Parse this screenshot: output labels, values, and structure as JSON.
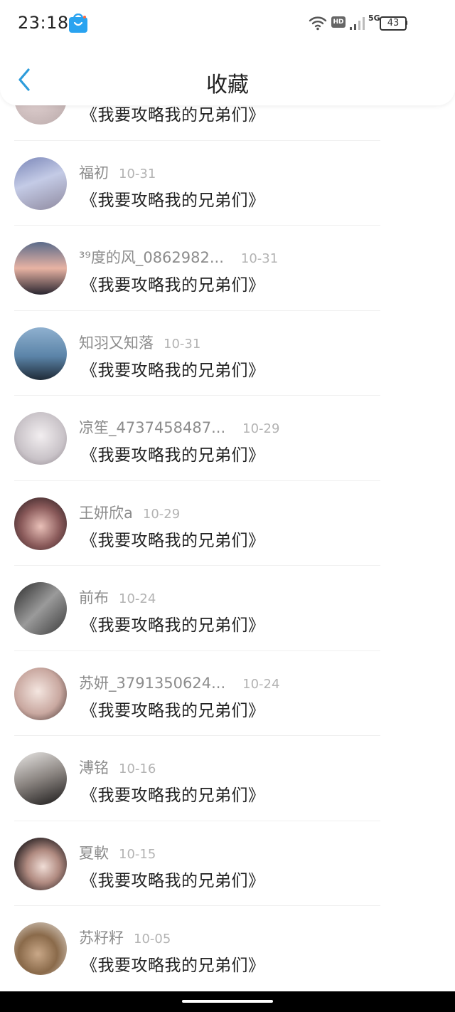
{
  "status_bar": {
    "time": "23:18",
    "network": "5G",
    "hd": "HD",
    "battery": "43"
  },
  "nav": {
    "title": "收藏",
    "back_icon": "chevron-left-icon",
    "accent_color": "#2d9cdb"
  },
  "list": {
    "items": [
      {
        "username": "",
        "date": "",
        "title": "《我要攻略我的兄弟们》"
      },
      {
        "username": "福初",
        "date": "10-31",
        "title": "《我要攻略我的兄弟们》"
      },
      {
        "username": "³⁹度的风_0862982...",
        "date": "10-31",
        "title": "《我要攻略我的兄弟们》"
      },
      {
        "username": "知羽又知落",
        "date": "10-31",
        "title": "《我要攻略我的兄弟们》"
      },
      {
        "username": "凉笙_4737458487...",
        "date": "10-29",
        "title": "《我要攻略我的兄弟们》"
      },
      {
        "username": "王妍欣a",
        "date": "10-29",
        "title": "《我要攻略我的兄弟们》"
      },
      {
        "username": "前布",
        "date": "10-24",
        "title": "《我要攻略我的兄弟们》"
      },
      {
        "username": "苏妍_3791350624...",
        "date": "10-24",
        "title": "《我要攻略我的兄弟们》"
      },
      {
        "username": "溥铭",
        "date": "10-16",
        "title": "《我要攻略我的兄弟们》"
      },
      {
        "username": "夏軟",
        "date": "10-15",
        "title": "《我要攻略我的兄弟们》"
      },
      {
        "username": "苏籽籽",
        "date": "10-05",
        "title": "《我要攻略我的兄弟们》"
      }
    ]
  }
}
